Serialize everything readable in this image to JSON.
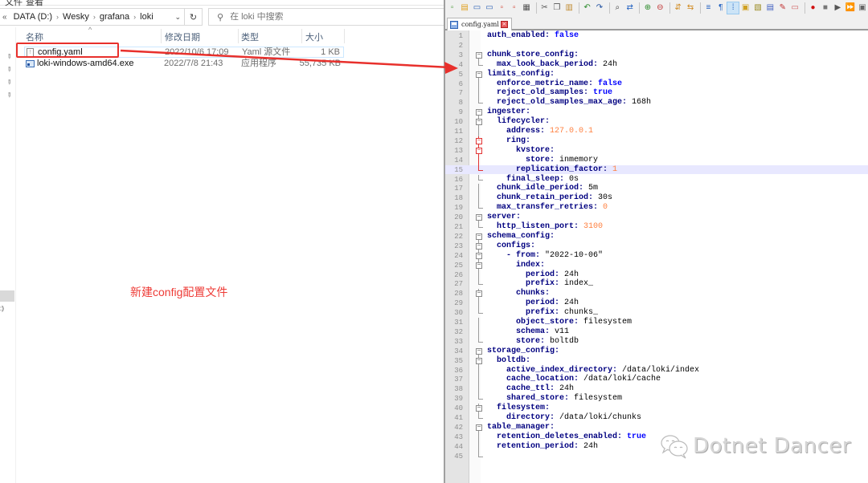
{
  "explorer": {
    "ribbon_tabs": [
      "文件",
      "查看"
    ],
    "breadcrumb": [
      "«",
      "DATA (D:)",
      "Wesky",
      "grafana",
      "loki"
    ],
    "search_placeholder": "在 loki 中搜索",
    "columns": {
      "name": "名称",
      "date": "修改日期",
      "type": "类型",
      "size": "大小"
    },
    "files": [
      {
        "name": "config.yaml",
        "date": "2022/10/6 17:09",
        "type": "Yaml 源文件",
        "size": "1 KB",
        "icon": "yaml-file-icon"
      },
      {
        "name": "loki-windows-amd64.exe",
        "date": "2022/7/8 21:43",
        "type": "应用程序",
        "size": "55,735 KB",
        "icon": "exe-file-icon"
      }
    ],
    "nav_partial_text": ":)"
  },
  "annotation": {
    "text": "新建config配置文件",
    "color": "#ee3b36"
  },
  "notepad": {
    "toolbar_icons": [
      "new-file-icon",
      "open-file-icon",
      "save-icon",
      "save-all-icon",
      "close-icon",
      "close-all-icon",
      "print-icon",
      "|",
      "cut-icon",
      "copy-icon",
      "paste-icon",
      "|",
      "undo-icon",
      "redo-icon",
      "|",
      "find-icon",
      "replace-icon",
      "|",
      "zoom-in-icon",
      "zoom-out-icon",
      "|",
      "sync-vertical-icon",
      "sync-horizontal-icon",
      "|",
      "word-wrap-icon",
      "show-all-chars-icon",
      "indent-guide-icon",
      "udl-icon",
      "doc-map-icon",
      "function-list-icon",
      "folder-workspace-icon",
      "monitor-icon",
      "|",
      "record-macro-icon",
      "stop-record-icon",
      "play-macro-icon",
      "run-macro-multiple-icon",
      "save-macro-icon"
    ],
    "tab_label": "config.yaml",
    "current_line": 15,
    "lines": [
      {
        "n": "1",
        "indent": 0,
        "key": "auth_enabled",
        "value": "false",
        "vtype": "bool",
        "fold": ""
      },
      {
        "n": "2",
        "indent": 0,
        "key": "",
        "value": "",
        "vtype": "",
        "fold": ""
      },
      {
        "n": "3",
        "indent": 0,
        "key": "chunk_store_config",
        "value": "",
        "vtype": "",
        "fold": "open"
      },
      {
        "n": "4",
        "indent": 1,
        "key": "max_look_back_period",
        "value": "24h",
        "vtype": "plain",
        "fold": "end"
      },
      {
        "n": "5",
        "indent": 0,
        "key": "limits_config",
        "value": "",
        "vtype": "",
        "fold": "open"
      },
      {
        "n": "6",
        "indent": 1,
        "key": "enforce_metric_name",
        "value": "false",
        "vtype": "bool",
        "fold": "line"
      },
      {
        "n": "7",
        "indent": 1,
        "key": "reject_old_samples",
        "value": "true",
        "vtype": "bool",
        "fold": "line"
      },
      {
        "n": "8",
        "indent": 1,
        "key": "reject_old_samples_max_age",
        "value": "168h",
        "vtype": "plain",
        "fold": "end"
      },
      {
        "n": "9",
        "indent": 0,
        "key": "ingester",
        "value": "",
        "vtype": "",
        "fold": "open"
      },
      {
        "n": "10",
        "indent": 1,
        "key": "lifecycler",
        "value": "",
        "vtype": "",
        "fold": "open"
      },
      {
        "n": "11",
        "indent": 2,
        "key": "address",
        "value": "127.0.0.1",
        "vtype": "num",
        "fold": "line"
      },
      {
        "n": "12",
        "indent": 2,
        "key": "ring",
        "value": "",
        "vtype": "",
        "fold": "open-red"
      },
      {
        "n": "13",
        "indent": 3,
        "key": "kvstore",
        "value": "",
        "vtype": "",
        "fold": "open-red"
      },
      {
        "n": "14",
        "indent": 4,
        "key": "store",
        "value": "inmemory",
        "vtype": "plain",
        "fold": "line-red"
      },
      {
        "n": "15",
        "indent": 3,
        "key": "replication_factor",
        "value": "1",
        "vtype": "num",
        "fold": "end-red"
      },
      {
        "n": "16",
        "indent": 2,
        "key": "final_sleep",
        "value": "0s",
        "vtype": "plain",
        "fold": "end"
      },
      {
        "n": "17",
        "indent": 1,
        "key": "chunk_idle_period",
        "value": "5m",
        "vtype": "plain",
        "fold": "line"
      },
      {
        "n": "18",
        "indent": 1,
        "key": "chunk_retain_period",
        "value": "30s",
        "vtype": "plain",
        "fold": "line"
      },
      {
        "n": "19",
        "indent": 1,
        "key": "max_transfer_retries",
        "value": "0",
        "vtype": "num",
        "fold": "end"
      },
      {
        "n": "20",
        "indent": 0,
        "key": "server",
        "value": "",
        "vtype": "",
        "fold": "open"
      },
      {
        "n": "21",
        "indent": 1,
        "key": "http_listen_port",
        "value": "3100",
        "vtype": "num",
        "fold": "end"
      },
      {
        "n": "22",
        "indent": 0,
        "key": "schema_config",
        "value": "",
        "vtype": "",
        "fold": "open"
      },
      {
        "n": "23",
        "indent": 1,
        "key": "configs",
        "value": "",
        "vtype": "",
        "fold": "open"
      },
      {
        "n": "24",
        "indent": 2,
        "key": "- from",
        "value": "\"2022-10-06\"",
        "vtype": "plain",
        "fold": "open"
      },
      {
        "n": "25",
        "indent": 3,
        "key": "index",
        "value": "",
        "vtype": "",
        "fold": "open"
      },
      {
        "n": "26",
        "indent": 4,
        "key": "period",
        "value": "24h",
        "vtype": "plain",
        "fold": "line"
      },
      {
        "n": "27",
        "indent": 4,
        "key": "prefix",
        "value": "index_",
        "vtype": "plain",
        "fold": "end"
      },
      {
        "n": "28",
        "indent": 3,
        "key": "chunks",
        "value": "",
        "vtype": "",
        "fold": "open"
      },
      {
        "n": "29",
        "indent": 4,
        "key": "period",
        "value": "24h",
        "vtype": "plain",
        "fold": "line"
      },
      {
        "n": "30",
        "indent": 4,
        "key": "prefix",
        "value": "chunks_",
        "vtype": "plain",
        "fold": "end"
      },
      {
        "n": "31",
        "indent": 3,
        "key": "object_store",
        "value": "filesystem",
        "vtype": "plain",
        "fold": "line"
      },
      {
        "n": "32",
        "indent": 3,
        "key": "schema",
        "value": "v11",
        "vtype": "plain",
        "fold": "line"
      },
      {
        "n": "33",
        "indent": 3,
        "key": "store",
        "value": "boltdb",
        "vtype": "plain",
        "fold": "end"
      },
      {
        "n": "34",
        "indent": 0,
        "key": "storage_config",
        "value": "",
        "vtype": "",
        "fold": "open"
      },
      {
        "n": "35",
        "indent": 1,
        "key": "boltdb",
        "value": "",
        "vtype": "",
        "fold": "open"
      },
      {
        "n": "36",
        "indent": 2,
        "key": "active_index_directory",
        "value": "/data/loki/index",
        "vtype": "plain",
        "fold": "line"
      },
      {
        "n": "37",
        "indent": 2,
        "key": "cache_location",
        "value": "/data/loki/cache",
        "vtype": "plain",
        "fold": "line"
      },
      {
        "n": "38",
        "indent": 2,
        "key": "cache_ttl",
        "value": "24h",
        "vtype": "plain",
        "fold": "line"
      },
      {
        "n": "39",
        "indent": 2,
        "key": "shared_store",
        "value": "filesystem",
        "vtype": "plain",
        "fold": "end"
      },
      {
        "n": "40",
        "indent": 1,
        "key": "filesystem",
        "value": "",
        "vtype": "",
        "fold": "open"
      },
      {
        "n": "41",
        "indent": 2,
        "key": "directory",
        "value": "/data/loki/chunks",
        "vtype": "plain",
        "fold": "end"
      },
      {
        "n": "42",
        "indent": 0,
        "key": "table_manager",
        "value": "",
        "vtype": "",
        "fold": "open"
      },
      {
        "n": "43",
        "indent": 1,
        "key": "retention_deletes_enabled",
        "value": "true",
        "vtype": "bool",
        "fold": "line"
      },
      {
        "n": "44",
        "indent": 1,
        "key": "retention_period",
        "value": "24h",
        "vtype": "plain",
        "fold": "line"
      },
      {
        "n": "45",
        "indent": 0,
        "key": "",
        "value": "",
        "vtype": "",
        "fold": "end"
      }
    ]
  },
  "watermark": {
    "text": "Dotnet Dancer"
  }
}
